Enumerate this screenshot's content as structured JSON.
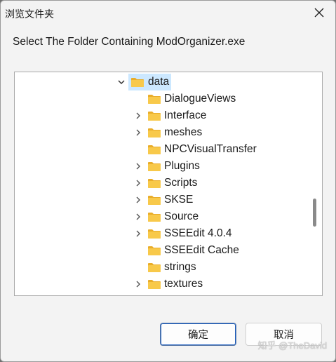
{
  "window": {
    "title": "浏览文件夹"
  },
  "prompt": "Select The Folder Containing ModOrganizer.exe",
  "tree": {
    "items": [
      {
        "label": "data",
        "expanded": true,
        "has_children": true,
        "selected": true,
        "level": 0
      },
      {
        "label": "DialogueViews",
        "has_children": false,
        "level": 1
      },
      {
        "label": "Interface",
        "has_children": true,
        "level": 1
      },
      {
        "label": "meshes",
        "has_children": true,
        "level": 1
      },
      {
        "label": "NPCVisualTransfer",
        "has_children": false,
        "level": 1
      },
      {
        "label": "Plugins",
        "has_children": true,
        "level": 1
      },
      {
        "label": "Scripts",
        "has_children": true,
        "level": 1
      },
      {
        "label": "SKSE",
        "has_children": true,
        "level": 1
      },
      {
        "label": "Source",
        "has_children": true,
        "level": 1
      },
      {
        "label": "SSEEdit 4.0.4",
        "has_children": true,
        "level": 1
      },
      {
        "label": "SSEEdit Cache",
        "has_children": false,
        "level": 1
      },
      {
        "label": "strings",
        "has_children": false,
        "level": 1
      },
      {
        "label": "textures",
        "has_children": true,
        "level": 1
      }
    ]
  },
  "buttons": {
    "ok_label": "确定",
    "cancel_label": "取消"
  },
  "watermark": "知乎 @TheDavid",
  "colors": {
    "selection": "#cce8ff",
    "folder": "#f8c94a",
    "ok_border": "#1f5fbf"
  }
}
